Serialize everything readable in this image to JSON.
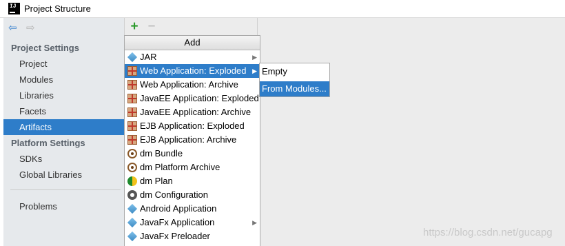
{
  "window": {
    "title": "Project Structure",
    "logo_text": "IJ"
  },
  "nav": {
    "back_icon": "arrow-left-icon",
    "forward_icon": "arrow-right-icon"
  },
  "sidebar": {
    "project_settings_header": "Project Settings",
    "project_settings_items": [
      {
        "label": "Project"
      },
      {
        "label": "Modules"
      },
      {
        "label": "Libraries"
      },
      {
        "label": "Facets"
      },
      {
        "label": "Artifacts",
        "selected": true
      }
    ],
    "platform_settings_header": "Platform Settings",
    "platform_settings_items": [
      {
        "label": "SDKs"
      },
      {
        "label": "Global Libraries"
      }
    ],
    "problems_label": "Problems"
  },
  "toolbar": {
    "add_symbol": "+",
    "remove_symbol": "−"
  },
  "add_menu": {
    "header": "Add",
    "items": [
      {
        "label": "JAR",
        "icon": "jar-icon",
        "submenu": true
      },
      {
        "label": "Web Application: Exploded",
        "icon": "web-app-exploded-icon",
        "submenu": true,
        "highlighted": true
      },
      {
        "label": "Web Application: Archive",
        "icon": "web-app-archive-icon"
      },
      {
        "label": "JavaEE Application: Exploded",
        "icon": "javaee-exploded-icon"
      },
      {
        "label": "JavaEE Application: Archive",
        "icon": "javaee-archive-icon"
      },
      {
        "label": "EJB Application: Exploded",
        "icon": "ejb-exploded-icon"
      },
      {
        "label": "EJB Application: Archive",
        "icon": "ejb-archive-icon"
      },
      {
        "label": "dm Bundle",
        "icon": "dm-bundle-icon"
      },
      {
        "label": "dm Platform Archive",
        "icon": "dm-platform-archive-icon"
      },
      {
        "label": "dm Plan",
        "icon": "dm-plan-icon"
      },
      {
        "label": "dm Configuration",
        "icon": "dm-configuration-icon"
      },
      {
        "label": "Android Application",
        "icon": "android-app-icon"
      },
      {
        "label": "JavaFx Application",
        "icon": "javafx-app-icon",
        "submenu": true
      },
      {
        "label": "JavaFx Preloader",
        "icon": "javafx-preloader-icon"
      }
    ]
  },
  "submenu": {
    "items": [
      {
        "label": "Empty"
      },
      {
        "label": "From Modules...",
        "highlighted": true
      }
    ]
  },
  "watermark": "https://blog.csdn.net/gucapg",
  "colors": {
    "selection": "#2e7dc9",
    "add_green": "#2c9a2c",
    "sidebar_bg": "#e6e9ec"
  }
}
